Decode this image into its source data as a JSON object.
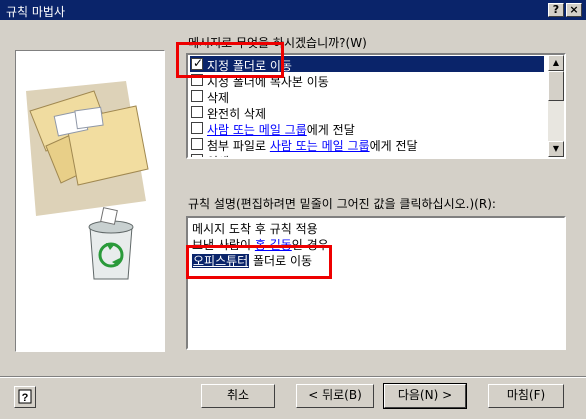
{
  "window": {
    "title": "규칙 마법사",
    "help_glyph": "?",
    "close_glyph": "×"
  },
  "actions": {
    "label": "메시지로 무엇을 하시겠습니까?(W)",
    "items": [
      {
        "checked": true,
        "selected": true,
        "parts": [
          {
            "text": "지정 폴더로 이동",
            "link": false
          }
        ]
      },
      {
        "checked": false,
        "selected": false,
        "parts": [
          {
            "text": "지정 폴더에 복사본 이동",
            "link": false
          }
        ]
      },
      {
        "checked": false,
        "selected": false,
        "parts": [
          {
            "text": "삭제",
            "link": false
          }
        ]
      },
      {
        "checked": false,
        "selected": false,
        "parts": [
          {
            "text": "완전히 삭제",
            "link": false
          }
        ]
      },
      {
        "checked": false,
        "selected": false,
        "parts": [
          {
            "text": "사람 또는 메일 그룹",
            "link": true
          },
          {
            "text": "에게 전달",
            "link": false
          }
        ]
      },
      {
        "checked": false,
        "selected": false,
        "parts": [
          {
            "text": "첨부 파일로 ",
            "link": false
          },
          {
            "text": "사람 또는 메일 그룹",
            "link": true
          },
          {
            "text": "에게 전달",
            "link": false
          }
        ]
      },
      {
        "checked": false,
        "selected": false,
        "parts": [
          {
            "text": "인쇄",
            "link": false
          }
        ]
      }
    ]
  },
  "description": {
    "label": "규칙 설명(편집하려면 밑줄이 그어진 값을 클릭하십시오.)(R):",
    "line1": "메시지 도착 후 규칙 적용",
    "line2_pre": "보낸 사람이 ",
    "line2_link": "홍 길동",
    "line2_post": "인 경우",
    "line3_link": "오피스튜터",
    "line3_post": " 폴더로 이동"
  },
  "buttons": {
    "cancel": "취소",
    "back": "< 뒤로(B)",
    "next": "다음(N) >",
    "finish": "마침(F)"
  },
  "colors": {
    "highlight": "#0a246a",
    "link": "#0000ff",
    "annotation": "#e00000"
  }
}
